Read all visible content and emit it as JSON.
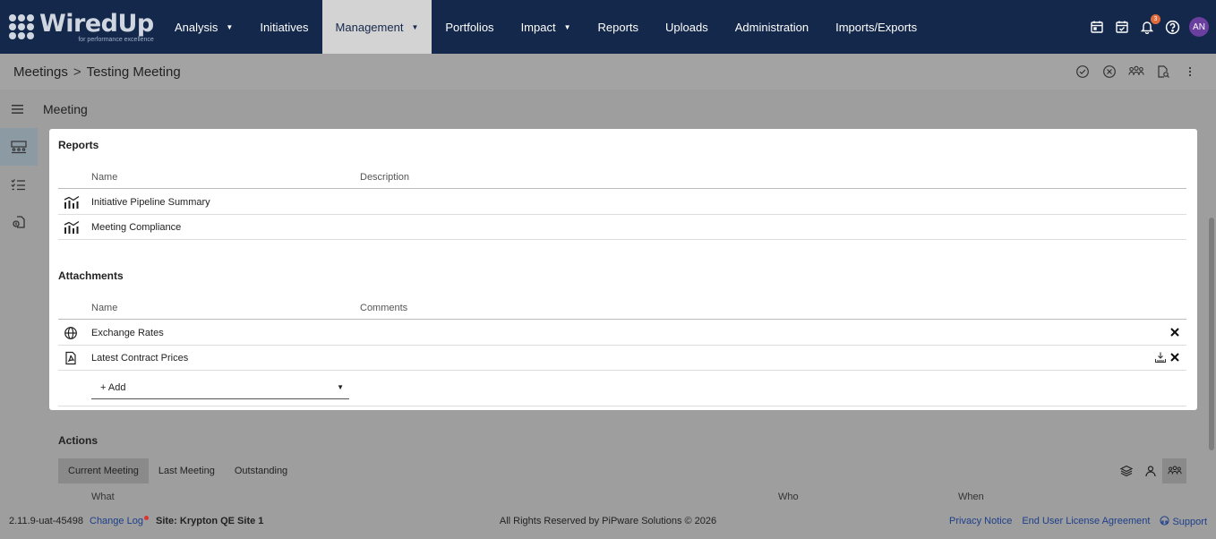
{
  "app": {
    "logo_text": "WiredUp",
    "logo_tagline": "for performance excellence"
  },
  "nav": {
    "items": [
      {
        "label": "Analysis",
        "dropdown": true
      },
      {
        "label": "Initiatives",
        "dropdown": false
      },
      {
        "label": "Management",
        "dropdown": true,
        "active": true
      },
      {
        "label": "Portfolios",
        "dropdown": false
      },
      {
        "label": "Impact",
        "dropdown": true
      },
      {
        "label": "Reports",
        "dropdown": false
      },
      {
        "label": "Uploads",
        "dropdown": false
      },
      {
        "label": "Administration",
        "dropdown": false
      },
      {
        "label": "Imports/Exports",
        "dropdown": false
      }
    ],
    "right_icons": [
      "calendar-icon",
      "calendar-check-icon",
      "bell-icon",
      "help-icon"
    ],
    "notification_count": "3",
    "avatar_initials": "AN"
  },
  "breadcrumb": {
    "parent": "Meetings",
    "separator": ">",
    "current": "Testing Meeting",
    "actions": [
      "check-circle-icon",
      "cancel-circle-icon",
      "attendees-icon",
      "document-search-icon",
      "more-vertical-icon"
    ]
  },
  "meeting_bar": {
    "title": "Meeting"
  },
  "rail": {
    "items": [
      "meeting-layout-icon",
      "checklist-icon",
      "document-link-icon"
    ]
  },
  "reports": {
    "title": "Reports",
    "columns": [
      "Name",
      "Description"
    ],
    "rows": [
      {
        "name": "Initiative Pipeline Summary",
        "description": "",
        "icon": "chart-icon"
      },
      {
        "name": "Meeting Compliance",
        "description": "",
        "icon": "chart-icon"
      }
    ]
  },
  "attachments": {
    "title": "Attachments",
    "columns": [
      "Name",
      "Comments"
    ],
    "rows": [
      {
        "name": "Exchange Rates",
        "icon": "globe-icon"
      },
      {
        "name": "Latest Contract Prices",
        "icon": "pdf-icon"
      }
    ],
    "add_label": "+ Add"
  },
  "actions": {
    "title": "Actions",
    "tabs": [
      "Current Meeting",
      "Last Meeting",
      "Outstanding"
    ],
    "active_tab": "Current Meeting",
    "columns": [
      "What",
      "Who",
      "When"
    ]
  },
  "footer": {
    "version": "2.11.9-uat-45498",
    "change_log": "Change Log",
    "site": "Site: Krypton QE Site 1",
    "rights": "All Rights Reserved by PiPware Solutions © 2026",
    "privacy": "Privacy Notice",
    "eula": "End User License Agreement",
    "support": "Support"
  },
  "colors": {
    "nav_bg": "#14284b",
    "active_nav_bg": "#d3d3d3",
    "link": "#1d3f8a",
    "avatar": "#6b3fa0",
    "badge": "#e0693a"
  }
}
